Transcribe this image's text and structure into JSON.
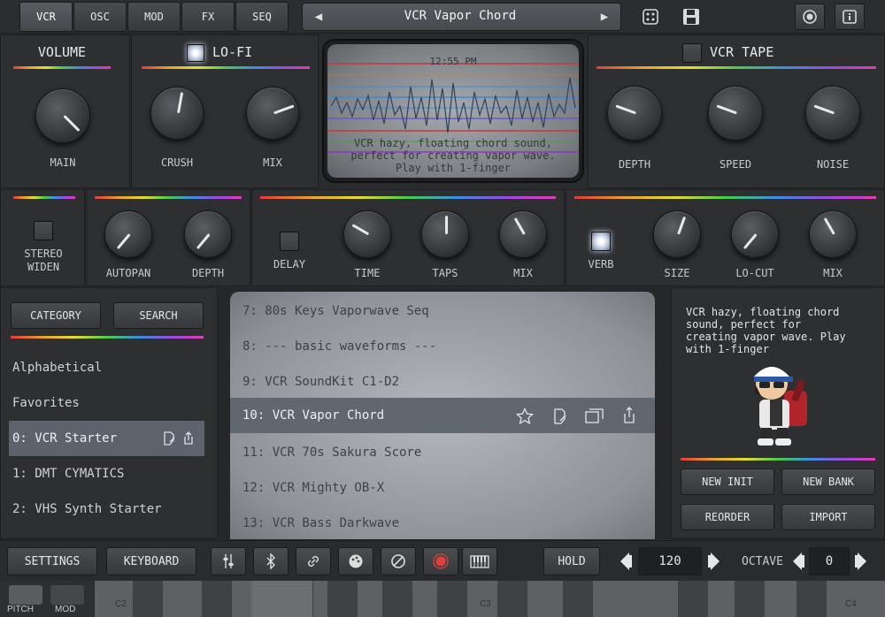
{
  "tabs": [
    {
      "label": "VCR",
      "active": true
    },
    {
      "label": "OSC"
    },
    {
      "label": "MOD"
    },
    {
      "label": "FX"
    },
    {
      "label": "SEQ"
    }
  ],
  "preset": {
    "name": "VCR Vapor Chord"
  },
  "display": {
    "time": "12:55 PM",
    "description": "VCR hazy, floating chord sound, perfect for creating vapor wave. Play with 1-finger",
    "lines": [
      "VCR hazy, floating chord sound,",
      "perfect for creating vapor wave.",
      "Play with 1-finger"
    ]
  },
  "volume": {
    "title": "VOLUME",
    "main": "MAIN"
  },
  "lofi": {
    "title": "LO-FI",
    "crush": "CRUSH",
    "mix": "MIX"
  },
  "tape": {
    "title": "VCR TAPE",
    "depth": "DEPTH",
    "speed": "SPEED",
    "noise": "NOISE"
  },
  "stereo": {
    "label_line1": "STEREO",
    "label_line2": "WIDEN"
  },
  "autopan": {
    "autopan": "AUTOPAN",
    "depth": "DEPTH"
  },
  "delay": {
    "toggle": "DELAY",
    "time": "TIME",
    "taps": "TAPS",
    "mix": "MIX"
  },
  "verb": {
    "toggle": "VERB",
    "size": "SIZE",
    "locut": "LO-CUT",
    "mix": "MIX"
  },
  "browser": {
    "category": "CATEGORY",
    "search": "SEARCH",
    "left_items": [
      "Alphabetical",
      "Favorites",
      "0: VCR Starter",
      "1: DMT CYMATICS",
      "2: VHS Synth Starter"
    ],
    "list": [
      "7: 80s Keys Vaporwave Seq",
      "8: --- basic waveforms ---",
      "9: VCR SoundKit C1-D2",
      "10: VCR Vapor Chord",
      "11: VCR 70s Sakura Score",
      "12: VCR Mighty OB-X",
      "13: VCR Bass Darkwave"
    ],
    "selected_index": 3,
    "info_lines": [
      "VCR hazy, floating chord",
      "sound, perfect for",
      "creating vapor wave. Play",
      "with 1-finger"
    ],
    "new_init": "NEW INIT",
    "new_bank": "NEW BANK",
    "reorder": "REORDER",
    "import": "IMPORT"
  },
  "bottom": {
    "settings": "SETTINGS",
    "keyboard": "KEYBOARD",
    "hold": "HOLD",
    "tempo": "120",
    "octave_label": "OCTAVE",
    "octave": "0",
    "pitch": "PITCH",
    "mod": "MOD",
    "c2": "C2",
    "c3": "C3",
    "c4": "C4"
  }
}
